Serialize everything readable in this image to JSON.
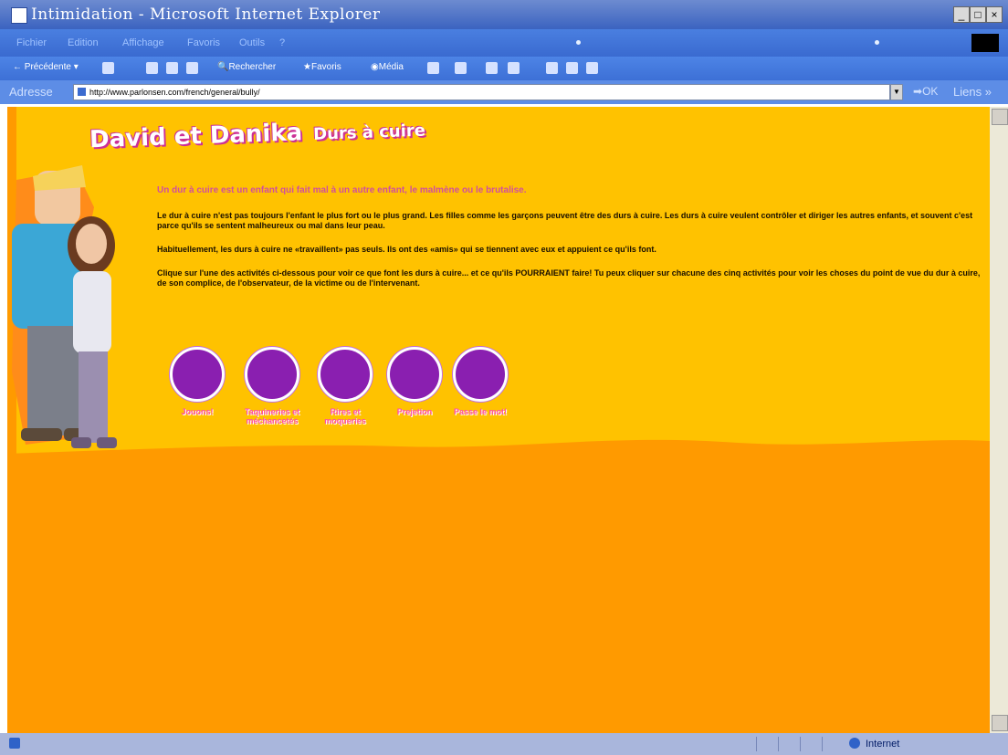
{
  "window": {
    "title": "Intimidation - Microsoft Internet Explorer",
    "controls": [
      "_",
      "□",
      "×"
    ]
  },
  "menubar": {
    "items": [
      "Fichier",
      "Edition",
      "Affichage",
      "Favoris",
      "Outils",
      "?"
    ]
  },
  "toolbar": {
    "back_label": "Précédente",
    "search_label": "Rechercher",
    "favorites_label": "Favoris",
    "media_label": "Média"
  },
  "addressbar": {
    "label": "Adresse",
    "url": "http://www.parlonsen.com/french/general/bully/",
    "go_label": "OK",
    "links_label": "Liens"
  },
  "page": {
    "heading_main": "David et Danika",
    "heading_sub": "Durs à cuire",
    "intro": "Un dur à cuire est un enfant qui fait mal à un autre enfant, le malmène ou le brutalise.",
    "p1": "Le dur à cuire n'est pas toujours l'enfant le plus fort ou le plus grand. Les filles comme les garçons peuvent être des durs à cuire. Les durs à cuire veulent contrôler et diriger les autres enfants, et souvent c'est parce qu'ils se sentent malheureux ou mal dans leur peau.",
    "p2": "Habituellement, les durs à cuire ne «travaillent» pas seuls. Ils ont des «amis» qui se tiennent avec eux et appuient ce qu'ils font.",
    "p3": "Clique sur l'une des activités ci-dessous pour voir ce que font les durs à cuire... et ce qu'ils POURRAIENT faire! Tu peux cliquer sur chacune des cinq activités pour voir les choses du point de vue du dur à cuire, de son complice, de l'observateur, de la victime ou de l'intervenant.",
    "activities": [
      {
        "label": "Jouons!"
      },
      {
        "label": "Taquineries et méchancetés"
      },
      {
        "label": "Rires et moqueries"
      },
      {
        "label": "Prejetion"
      },
      {
        "label": "Passe le mot!"
      }
    ]
  },
  "statusbar": {
    "zone": "Internet"
  },
  "colors": {
    "page_yellow": "#ffc200",
    "page_orange": "#ff9a00",
    "heading_pink": "#cc2f96",
    "activity_purple": "#8a1fb0"
  }
}
